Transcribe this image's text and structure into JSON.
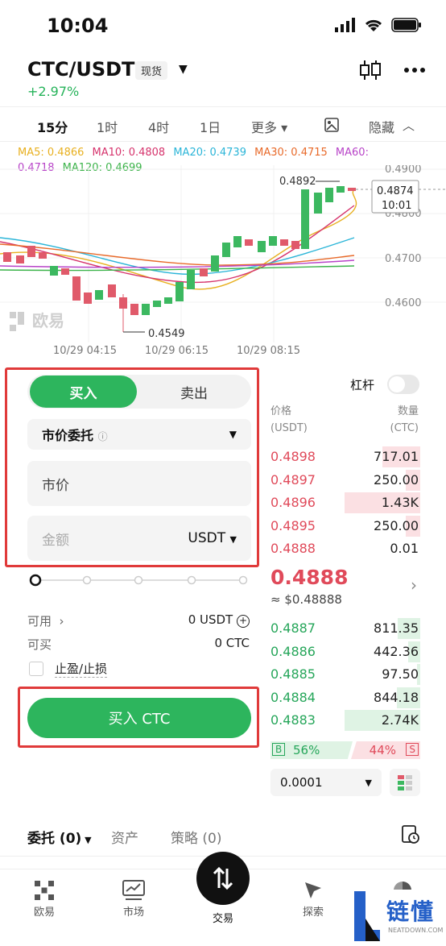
{
  "status": {
    "time": "10:04"
  },
  "header": {
    "pair": "CTC/USDT",
    "badge": "现货",
    "change": "+2.97%"
  },
  "timeframes": [
    "15分",
    "1时",
    "4时",
    "1日",
    "更多 ▾",
    "隐藏"
  ],
  "ma": [
    {
      "label": "MA5: 0.4866",
      "color": "#e8b020"
    },
    {
      "label": "MA10: 0.4808",
      "color": "#d6336c"
    },
    {
      "label": "MA20: 0.4739",
      "color": "#2bb5d8"
    },
    {
      "label": "MA30: 0.4715",
      "color": "#e86a2a"
    },
    {
      "label": "MA60: 0.4718",
      "color": "#b844c8"
    },
    {
      "label": "MA120: 0.4699",
      "color": "#3cb34a"
    }
  ],
  "chart": {
    "price_labels": [
      "0.4900",
      "0.4800",
      "0.4700",
      "0.4600"
    ],
    "high_label": "0.4892",
    "low_label": "0.4549",
    "current_price": "0.4874",
    "current_time": "10:01",
    "time_labels": [
      "10/29 04:15",
      "10/29 06:15",
      "10/29 08:15"
    ],
    "watermark": "欧易"
  },
  "order_form": {
    "buy_label": "买入",
    "sell_label": "卖出",
    "order_type": "市价委托",
    "market_placeholder": "市价",
    "amount_placeholder": "金额",
    "amount_unit": "USDT",
    "available_label": "可用",
    "available_value": "0 USDT",
    "buyable_label": "可买",
    "buyable_value": "0 CTC",
    "tpsl_label": "止盈/止损",
    "submit_label": "买入 CTC"
  },
  "order_book": {
    "leverage_label": "杠杆",
    "price_header": "价格",
    "price_unit": "(USDT)",
    "qty_header": "数量",
    "qty_unit": "(CTC)",
    "asks": [
      {
        "price": "0.4898",
        "qty": "717.01",
        "depth": 0.5
      },
      {
        "price": "0.4897",
        "qty": "250.00",
        "depth": 0.19
      },
      {
        "price": "0.4896",
        "qty": "1.43K",
        "depth": 1.0
      },
      {
        "price": "0.4895",
        "qty": "250.00",
        "depth": 0.19
      },
      {
        "price": "0.4888",
        "qty": "0.01",
        "depth": 0.0
      }
    ],
    "last_price": "0.4888",
    "last_usd": "≈ $0.48888",
    "bids": [
      {
        "price": "0.4887",
        "qty": "811.35",
        "depth": 0.3
      },
      {
        "price": "0.4886",
        "qty": "442.36",
        "depth": 0.16
      },
      {
        "price": "0.4885",
        "qty": "97.50",
        "depth": 0.04
      },
      {
        "price": "0.4884",
        "qty": "844.18",
        "depth": 0.31
      },
      {
        "price": "0.4883",
        "qty": "2.74K",
        "depth": 1.0
      }
    ],
    "buy_ratio": "56%",
    "sell_ratio": "44%",
    "buy_tag": "B",
    "sell_tag": "S",
    "precision": "0.0001"
  },
  "bottom_tabs": {
    "orders": "委托 (0)",
    "assets": "资产",
    "strategy": "策略 (0)"
  },
  "nav": {
    "home": "欧易",
    "market": "市场",
    "trade": "交易",
    "explore": "探索"
  },
  "watermark_brand": {
    "text": "链懂",
    "sub": "NEATDOWN.COM"
  }
}
